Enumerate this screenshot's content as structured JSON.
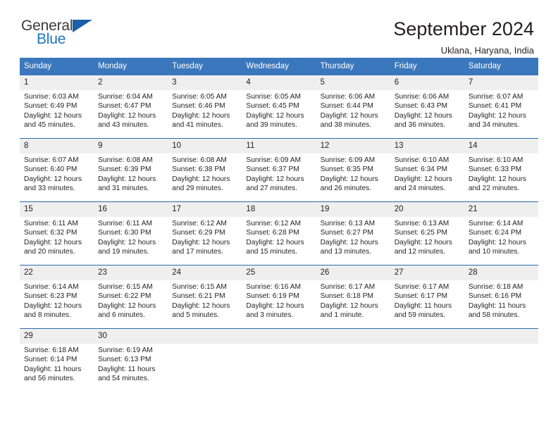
{
  "brand": {
    "name_top": "General",
    "name_bottom": "Blue",
    "accent_color": "#1b75bb",
    "triangle_color": "#1b5fa8"
  },
  "header": {
    "title": "September 2024",
    "subtitle": "Uklana, Haryana, India"
  },
  "calendar": {
    "header_bg": "#3b77bc",
    "daynum_bg": "#efefef",
    "weekdays": [
      "Sunday",
      "Monday",
      "Tuesday",
      "Wednesday",
      "Thursday",
      "Friday",
      "Saturday"
    ],
    "weeks": [
      [
        {
          "day": "1",
          "sunrise": "Sunrise: 6:03 AM",
          "sunset": "Sunset: 6:49 PM",
          "daylight_1": "Daylight: 12 hours",
          "daylight_2": "and 45 minutes."
        },
        {
          "day": "2",
          "sunrise": "Sunrise: 6:04 AM",
          "sunset": "Sunset: 6:47 PM",
          "daylight_1": "Daylight: 12 hours",
          "daylight_2": "and 43 minutes."
        },
        {
          "day": "3",
          "sunrise": "Sunrise: 6:05 AM",
          "sunset": "Sunset: 6:46 PM",
          "daylight_1": "Daylight: 12 hours",
          "daylight_2": "and 41 minutes."
        },
        {
          "day": "4",
          "sunrise": "Sunrise: 6:05 AM",
          "sunset": "Sunset: 6:45 PM",
          "daylight_1": "Daylight: 12 hours",
          "daylight_2": "and 39 minutes."
        },
        {
          "day": "5",
          "sunrise": "Sunrise: 6:06 AM",
          "sunset": "Sunset: 6:44 PM",
          "daylight_1": "Daylight: 12 hours",
          "daylight_2": "and 38 minutes."
        },
        {
          "day": "6",
          "sunrise": "Sunrise: 6:06 AM",
          "sunset": "Sunset: 6:43 PM",
          "daylight_1": "Daylight: 12 hours",
          "daylight_2": "and 36 minutes."
        },
        {
          "day": "7",
          "sunrise": "Sunrise: 6:07 AM",
          "sunset": "Sunset: 6:41 PM",
          "daylight_1": "Daylight: 12 hours",
          "daylight_2": "and 34 minutes."
        }
      ],
      [
        {
          "day": "8",
          "sunrise": "Sunrise: 6:07 AM",
          "sunset": "Sunset: 6:40 PM",
          "daylight_1": "Daylight: 12 hours",
          "daylight_2": "and 33 minutes."
        },
        {
          "day": "9",
          "sunrise": "Sunrise: 6:08 AM",
          "sunset": "Sunset: 6:39 PM",
          "daylight_1": "Daylight: 12 hours",
          "daylight_2": "and 31 minutes."
        },
        {
          "day": "10",
          "sunrise": "Sunrise: 6:08 AM",
          "sunset": "Sunset: 6:38 PM",
          "daylight_1": "Daylight: 12 hours",
          "daylight_2": "and 29 minutes."
        },
        {
          "day": "11",
          "sunrise": "Sunrise: 6:09 AM",
          "sunset": "Sunset: 6:37 PM",
          "daylight_1": "Daylight: 12 hours",
          "daylight_2": "and 27 minutes."
        },
        {
          "day": "12",
          "sunrise": "Sunrise: 6:09 AM",
          "sunset": "Sunset: 6:35 PM",
          "daylight_1": "Daylight: 12 hours",
          "daylight_2": "and 26 minutes."
        },
        {
          "day": "13",
          "sunrise": "Sunrise: 6:10 AM",
          "sunset": "Sunset: 6:34 PM",
          "daylight_1": "Daylight: 12 hours",
          "daylight_2": "and 24 minutes."
        },
        {
          "day": "14",
          "sunrise": "Sunrise: 6:10 AM",
          "sunset": "Sunset: 6:33 PM",
          "daylight_1": "Daylight: 12 hours",
          "daylight_2": "and 22 minutes."
        }
      ],
      [
        {
          "day": "15",
          "sunrise": "Sunrise: 6:11 AM",
          "sunset": "Sunset: 6:32 PM",
          "daylight_1": "Daylight: 12 hours",
          "daylight_2": "and 20 minutes."
        },
        {
          "day": "16",
          "sunrise": "Sunrise: 6:11 AM",
          "sunset": "Sunset: 6:30 PM",
          "daylight_1": "Daylight: 12 hours",
          "daylight_2": "and 19 minutes."
        },
        {
          "day": "17",
          "sunrise": "Sunrise: 6:12 AM",
          "sunset": "Sunset: 6:29 PM",
          "daylight_1": "Daylight: 12 hours",
          "daylight_2": "and 17 minutes."
        },
        {
          "day": "18",
          "sunrise": "Sunrise: 6:12 AM",
          "sunset": "Sunset: 6:28 PM",
          "daylight_1": "Daylight: 12 hours",
          "daylight_2": "and 15 minutes."
        },
        {
          "day": "19",
          "sunrise": "Sunrise: 6:13 AM",
          "sunset": "Sunset: 6:27 PM",
          "daylight_1": "Daylight: 12 hours",
          "daylight_2": "and 13 minutes."
        },
        {
          "day": "20",
          "sunrise": "Sunrise: 6:13 AM",
          "sunset": "Sunset: 6:25 PM",
          "daylight_1": "Daylight: 12 hours",
          "daylight_2": "and 12 minutes."
        },
        {
          "day": "21",
          "sunrise": "Sunrise: 6:14 AM",
          "sunset": "Sunset: 6:24 PM",
          "daylight_1": "Daylight: 12 hours",
          "daylight_2": "and 10 minutes."
        }
      ],
      [
        {
          "day": "22",
          "sunrise": "Sunrise: 6:14 AM",
          "sunset": "Sunset: 6:23 PM",
          "daylight_1": "Daylight: 12 hours",
          "daylight_2": "and 8 minutes."
        },
        {
          "day": "23",
          "sunrise": "Sunrise: 6:15 AM",
          "sunset": "Sunset: 6:22 PM",
          "daylight_1": "Daylight: 12 hours",
          "daylight_2": "and 6 minutes."
        },
        {
          "day": "24",
          "sunrise": "Sunrise: 6:15 AM",
          "sunset": "Sunset: 6:21 PM",
          "daylight_1": "Daylight: 12 hours",
          "daylight_2": "and 5 minutes."
        },
        {
          "day": "25",
          "sunrise": "Sunrise: 6:16 AM",
          "sunset": "Sunset: 6:19 PM",
          "daylight_1": "Daylight: 12 hours",
          "daylight_2": "and 3 minutes."
        },
        {
          "day": "26",
          "sunrise": "Sunrise: 6:17 AM",
          "sunset": "Sunset: 6:18 PM",
          "daylight_1": "Daylight: 12 hours",
          "daylight_2": "and 1 minute."
        },
        {
          "day": "27",
          "sunrise": "Sunrise: 6:17 AM",
          "sunset": "Sunset: 6:17 PM",
          "daylight_1": "Daylight: 11 hours",
          "daylight_2": "and 59 minutes."
        },
        {
          "day": "28",
          "sunrise": "Sunrise: 6:18 AM",
          "sunset": "Sunset: 6:16 PM",
          "daylight_1": "Daylight: 11 hours",
          "daylight_2": "and 58 minutes."
        }
      ],
      [
        {
          "day": "29",
          "sunrise": "Sunrise: 6:18 AM",
          "sunset": "Sunset: 6:14 PM",
          "daylight_1": "Daylight: 11 hours",
          "daylight_2": "and 56 minutes."
        },
        {
          "day": "30",
          "sunrise": "Sunrise: 6:19 AM",
          "sunset": "Sunset: 6:13 PM",
          "daylight_1": "Daylight: 11 hours",
          "daylight_2": "and 54 minutes."
        },
        {
          "day": "",
          "sunrise": "",
          "sunset": "",
          "daylight_1": "",
          "daylight_2": ""
        },
        {
          "day": "",
          "sunrise": "",
          "sunset": "",
          "daylight_1": "",
          "daylight_2": ""
        },
        {
          "day": "",
          "sunrise": "",
          "sunset": "",
          "daylight_1": "",
          "daylight_2": ""
        },
        {
          "day": "",
          "sunrise": "",
          "sunset": "",
          "daylight_1": "",
          "daylight_2": ""
        },
        {
          "day": "",
          "sunrise": "",
          "sunset": "",
          "daylight_1": "",
          "daylight_2": ""
        }
      ]
    ]
  }
}
